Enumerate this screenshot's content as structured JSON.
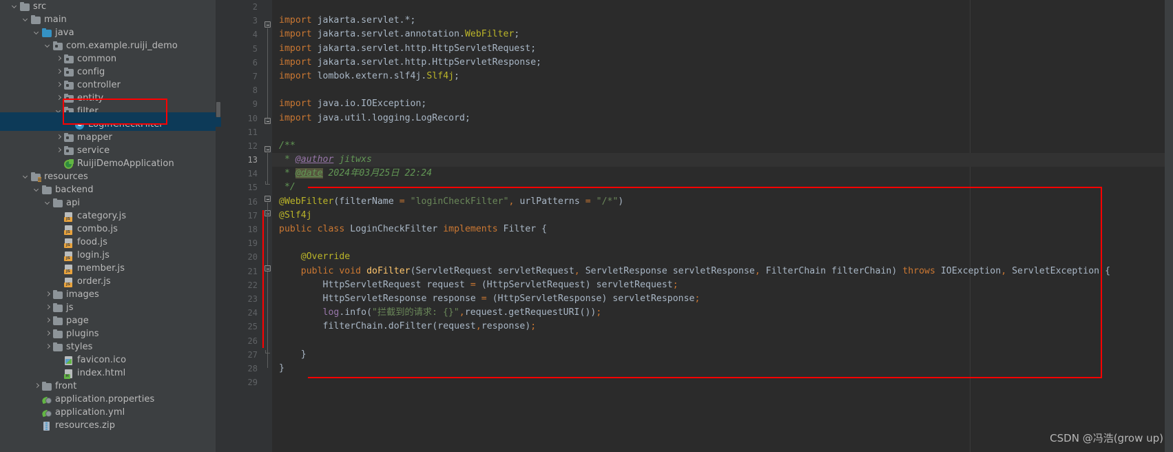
{
  "project_tree": {
    "items": [
      {
        "label": "src",
        "indent": 1,
        "arrow": "down",
        "icon": "folder-src-icon",
        "selected": false
      },
      {
        "label": "main",
        "indent": 2,
        "arrow": "down",
        "icon": "folder-gray-icon",
        "selected": false
      },
      {
        "label": "java",
        "indent": 3,
        "arrow": "down",
        "icon": "folder-blue-icon",
        "selected": false
      },
      {
        "label": "com.example.ruiji_demo",
        "indent": 4,
        "arrow": "down",
        "icon": "folder-package-icon",
        "selected": false
      },
      {
        "label": "common",
        "indent": 5,
        "arrow": "right",
        "icon": "folder-package-icon",
        "selected": false
      },
      {
        "label": "config",
        "indent": 5,
        "arrow": "right",
        "icon": "folder-package-icon",
        "selected": false
      },
      {
        "label": "controller",
        "indent": 5,
        "arrow": "right",
        "icon": "folder-package-icon",
        "selected": false
      },
      {
        "label": "entity",
        "indent": 5,
        "arrow": "right",
        "icon": "folder-package-icon",
        "selected": false
      },
      {
        "label": "filter",
        "indent": 5,
        "arrow": "down",
        "icon": "folder-package-icon",
        "selected": false
      },
      {
        "label": "LoginCheckFilter",
        "indent": 6,
        "arrow": "none",
        "icon": "java-class-icon",
        "selected": true
      },
      {
        "label": "mapper",
        "indent": 5,
        "arrow": "right",
        "icon": "folder-package-icon",
        "selected": false
      },
      {
        "label": "service",
        "indent": 5,
        "arrow": "right",
        "icon": "folder-package-icon",
        "selected": false
      },
      {
        "label": "RuijiDemoApplication",
        "indent": 5,
        "arrow": "none",
        "icon": "spring-boot-app-icon",
        "selected": false
      },
      {
        "label": "resources",
        "indent": 2,
        "arrow": "down",
        "icon": "folder-resources-icon",
        "selected": false
      },
      {
        "label": "backend",
        "indent": 3,
        "arrow": "down",
        "icon": "folder-gray-icon",
        "selected": false
      },
      {
        "label": "api",
        "indent": 4,
        "arrow": "down",
        "icon": "folder-gray-icon",
        "selected": false
      },
      {
        "label": "category.js",
        "indent": 5,
        "arrow": "none",
        "icon": "js-file-icon",
        "selected": false
      },
      {
        "label": "combo.js",
        "indent": 5,
        "arrow": "none",
        "icon": "js-file-icon",
        "selected": false
      },
      {
        "label": "food.js",
        "indent": 5,
        "arrow": "none",
        "icon": "js-file-icon",
        "selected": false
      },
      {
        "label": "login.js",
        "indent": 5,
        "arrow": "none",
        "icon": "js-file-icon",
        "selected": false
      },
      {
        "label": "member.js",
        "indent": 5,
        "arrow": "none",
        "icon": "js-file-icon",
        "selected": false
      },
      {
        "label": "order.js",
        "indent": 5,
        "arrow": "none",
        "icon": "js-file-icon",
        "selected": false
      },
      {
        "label": "images",
        "indent": 4,
        "arrow": "right",
        "icon": "folder-gray-icon",
        "selected": false
      },
      {
        "label": "js",
        "indent": 4,
        "arrow": "right",
        "icon": "folder-gray-icon",
        "selected": false
      },
      {
        "label": "page",
        "indent": 4,
        "arrow": "right",
        "icon": "folder-gray-icon",
        "selected": false
      },
      {
        "label": "plugins",
        "indent": 4,
        "arrow": "right",
        "icon": "folder-gray-icon",
        "selected": false
      },
      {
        "label": "styles",
        "indent": 4,
        "arrow": "right",
        "icon": "folder-gray-icon",
        "selected": false
      },
      {
        "label": "favicon.ico",
        "indent": 5,
        "arrow": "none",
        "icon": "image-file-icon",
        "selected": false
      },
      {
        "label": "index.html",
        "indent": 5,
        "arrow": "none",
        "icon": "html-file-icon",
        "selected": false
      },
      {
        "label": "front",
        "indent": 3,
        "arrow": "right",
        "icon": "folder-gray-icon",
        "selected": false
      },
      {
        "label": "application.properties",
        "indent": 3,
        "arrow": "none",
        "icon": "spring-properties-icon",
        "selected": false
      },
      {
        "label": "application.yml",
        "indent": 3,
        "arrow": "none",
        "icon": "spring-properties-icon",
        "selected": false
      },
      {
        "label": "resources.zip",
        "indent": 3,
        "arrow": "none",
        "icon": "zip-file-icon",
        "selected": false
      }
    ]
  },
  "editor": {
    "first_line_number": 2,
    "line_numbers": [
      2,
      3,
      4,
      5,
      6,
      7,
      8,
      9,
      10,
      11,
      12,
      13,
      14,
      15,
      16,
      17,
      18,
      19,
      20,
      21,
      22,
      23,
      24,
      25,
      26,
      27,
      28,
      29
    ],
    "current_line": 13,
    "lines": [
      {
        "n": 2,
        "text": ""
      },
      {
        "n": 3,
        "text": "import jakarta.servlet.*;"
      },
      {
        "n": 4,
        "text": "import jakarta.servlet.annotation.WebFilter;"
      },
      {
        "n": 5,
        "text": "import jakarta.servlet.http.HttpServletRequest;"
      },
      {
        "n": 6,
        "text": "import jakarta.servlet.http.HttpServletResponse;"
      },
      {
        "n": 7,
        "text": "import lombok.extern.slf4j.Slf4j;"
      },
      {
        "n": 8,
        "text": ""
      },
      {
        "n": 9,
        "text": "import java.io.IOException;"
      },
      {
        "n": 10,
        "text": "import java.util.logging.LogRecord;"
      },
      {
        "n": 11,
        "text": ""
      },
      {
        "n": 12,
        "text": "/**"
      },
      {
        "n": 13,
        "text": " * @author jitwxs"
      },
      {
        "n": 14,
        "text": " * @date 2024年03月25日 22:24"
      },
      {
        "n": 15,
        "text": " */"
      },
      {
        "n": 16,
        "text": "@WebFilter(filterName = \"loginCheckFilter\", urlPatterns = \"/*\")"
      },
      {
        "n": 17,
        "text": "@Slf4j"
      },
      {
        "n": 18,
        "text": "public class LoginCheckFilter implements Filter {"
      },
      {
        "n": 19,
        "text": ""
      },
      {
        "n": 20,
        "text": "    @Override"
      },
      {
        "n": 21,
        "text": "    public void doFilter(ServletRequest servletRequest, ServletResponse servletResponse, FilterChain filterChain) throws IOException, ServletException {"
      },
      {
        "n": 22,
        "text": "        HttpServletRequest request = (HttpServletRequest) servletRequest;"
      },
      {
        "n": 23,
        "text": "        HttpServletResponse response = (HttpServletResponse) servletResponse;"
      },
      {
        "n": 24,
        "text": "        log.info(\"拦截到的请求: {}\",request.getRequestURI());"
      },
      {
        "n": 25,
        "text": "        filterChain.doFilter(request,response);"
      },
      {
        "n": 26,
        "text": ""
      },
      {
        "n": 27,
        "text": "    }"
      },
      {
        "n": 28,
        "text": "}"
      },
      {
        "n": 29,
        "text": ""
      }
    ],
    "javadoc": {
      "author_tag": "@author",
      "author_value": "jitwxs",
      "date_tag": "@date",
      "date_value": "2024年03月25日 22:24"
    },
    "annotations": {
      "webfilter_name": "loginCheckFilter",
      "webfilter_url_patterns": "/*",
      "slf4j": "@Slf4j",
      "override": "@Override"
    },
    "log_message": "拦截到的请求: {}"
  },
  "colors": {
    "background_editor": "#2b2b2b",
    "background_panel": "#3c3f41",
    "gutter": "#313335",
    "selection": "#0d3a58",
    "annotation_box": "#ff0000",
    "keyword": "#cc7832",
    "string": "#6a8759",
    "comment": "#629755",
    "annotation": "#bbb529",
    "method": "#ffc66d",
    "field": "#9876aa",
    "text": "#a9b7c6"
  },
  "watermark": {
    "text": "CSDN @冯浩(grow up)"
  }
}
